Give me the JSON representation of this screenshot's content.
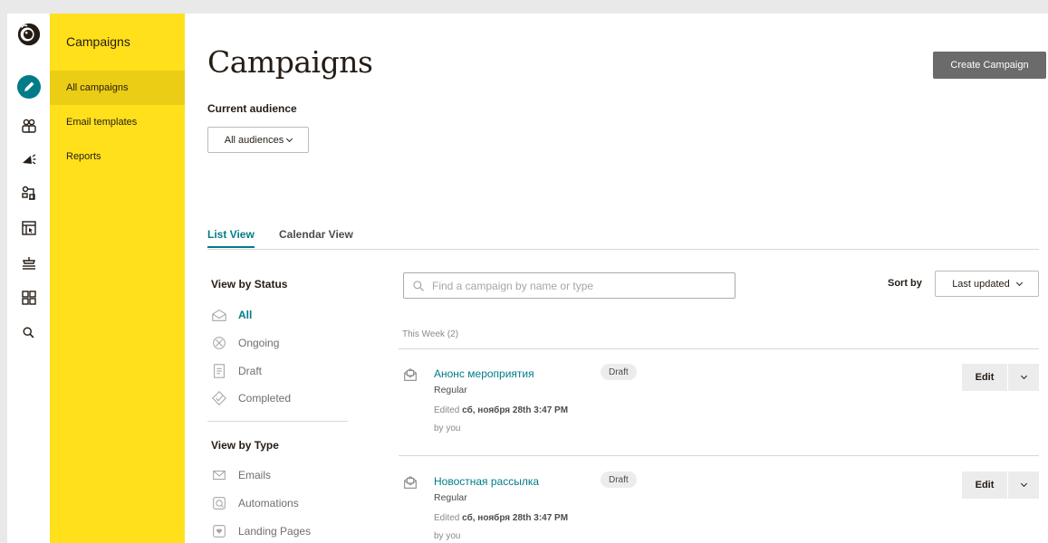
{
  "rail": {
    "items": [
      {
        "icon": "mailchimp-logo-icon"
      },
      {
        "icon": "pencil-icon"
      },
      {
        "icon": "audience-icon"
      },
      {
        "icon": "megaphone-icon"
      },
      {
        "icon": "automation-icon"
      },
      {
        "icon": "website-icon"
      },
      {
        "icon": "integrations-icon"
      },
      {
        "icon": "grid-icon"
      },
      {
        "icon": "search-icon"
      }
    ]
  },
  "subnav": {
    "title": "Campaigns",
    "items": [
      {
        "label": "All campaigns",
        "active": true
      },
      {
        "label": "Email templates",
        "active": false
      },
      {
        "label": "Reports",
        "active": false
      }
    ]
  },
  "header": {
    "title": "Campaigns",
    "create_button": "Create Campaign",
    "audience_label": "Current audience",
    "audience_value": "All audiences"
  },
  "tabs": [
    {
      "label": "List View",
      "active": true
    },
    {
      "label": "Calendar View",
      "active": false
    }
  ],
  "filters": {
    "status_heading": "View by Status",
    "status": [
      {
        "label": "All",
        "active": true,
        "icon": "all-campaigns-icon"
      },
      {
        "label": "Ongoing",
        "active": false,
        "icon": "ongoing-icon"
      },
      {
        "label": "Draft",
        "active": false,
        "icon": "draft-icon"
      },
      {
        "label": "Completed",
        "active": false,
        "icon": "completed-icon"
      }
    ],
    "type_heading": "View by Type",
    "types": [
      {
        "label": "Emails",
        "icon": "email-icon"
      },
      {
        "label": "Automations",
        "icon": "automations-icon"
      },
      {
        "label": "Landing Pages",
        "icon": "landing-page-icon"
      }
    ]
  },
  "search": {
    "placeholder": "Find a campaign by name or type"
  },
  "sort": {
    "label": "Sort by",
    "value": "Last updated"
  },
  "group": {
    "label": "This Week (2)"
  },
  "campaigns": [
    {
      "name": "Анонс мероприятия",
      "type": "Regular",
      "status": "Draft",
      "edited_prefix": "Edited",
      "edited_date": "сб, ноября 28th 3:47 PM",
      "by": "by you",
      "edit_label": "Edit"
    },
    {
      "name": "Новостная рассылка",
      "type": "Regular",
      "status": "Draft",
      "edited_prefix": "Edited",
      "edited_date": "сб, ноября 28th 3:47 PM",
      "by": "by you",
      "edit_label": "Edit"
    }
  ],
  "colors": {
    "accent": "#007c89",
    "nav_yellow": "#ffe01b",
    "nav_active": "#ebcd15",
    "create_button": "#6b6b6b"
  }
}
